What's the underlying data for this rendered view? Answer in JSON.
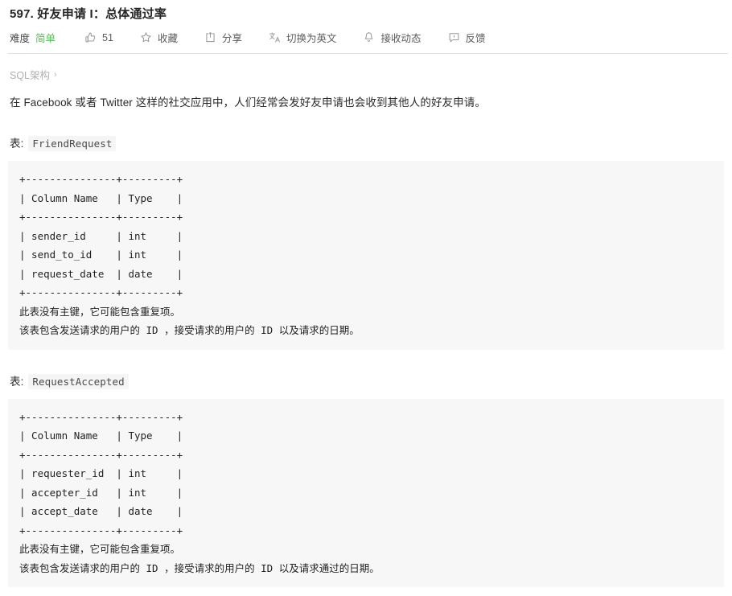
{
  "title": "597. 好友申请 I：总体通过率",
  "toolbar": {
    "difficulty_label": "难度",
    "difficulty_value": "简单",
    "like_icon": "thumbs-up-icon",
    "like_count": "51",
    "favorite_icon": "star-icon",
    "favorite_label": "收藏",
    "share_icon": "share-icon",
    "share_label": "分享",
    "translate_icon": "translate-icon",
    "translate_label": "切换为英文",
    "subscribe_icon": "bell-icon",
    "subscribe_label": "接收动态",
    "feedback_icon": "comment-icon",
    "feedback_label": "反馈",
    "difficulty_color": "#5cb85c"
  },
  "schema": {
    "label": "SQL架构",
    "chevron": "›"
  },
  "description": "在 Facebook 或者 Twitter 这样的社交应用中，人们经常会发好友申请也会收到其他人的好友申请。",
  "tables": [
    {
      "caption_prefix": "表: ",
      "caption_name": "FriendRequest",
      "block": "+---------------+---------+\n| Column Name   | Type    |\n+---------------+---------+\n| sender_id     | int     |\n| send_to_id    | int     |\n| request_date  | date    |\n+---------------+---------+\n此表没有主键，它可能包含重复项。\n该表包含发送请求的用户的 ID ，接受请求的用户的 ID 以及请求的日期。"
    },
    {
      "caption_prefix": "表: ",
      "caption_name": "RequestAccepted",
      "block": "+---------------+---------+\n| Column Name   | Type    |\n+---------------+---------+\n| requester_id  | int     |\n| accepter_id   | int     |\n| accept_date   | date    |\n+---------------+---------+\n此表没有主键，它可能包含重复项。\n该表包含发送请求的用户的 ID ，接受请求的用户的 ID 以及请求通过的日期。"
    }
  ]
}
